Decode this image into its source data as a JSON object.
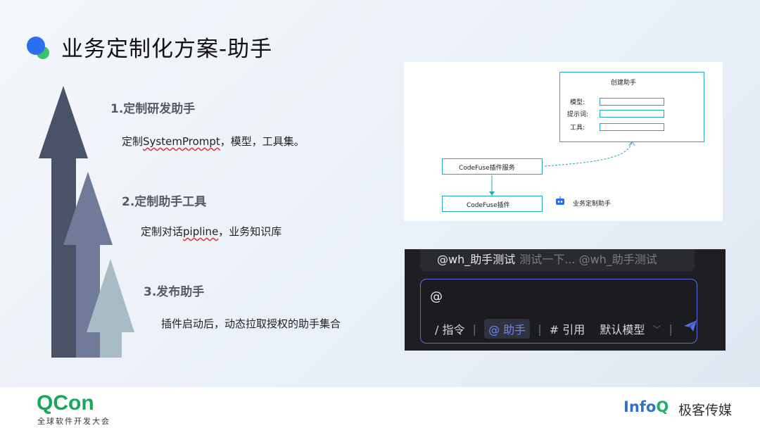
{
  "slide": {
    "title": "业务定制化方案-助手"
  },
  "steps": [
    {
      "title": "1.定制研发助手",
      "desc_prefix": "定制",
      "desc_mark": "SystemPrompt",
      "desc_suffix": "，模型，工具集。"
    },
    {
      "title": "2.定制助手工具",
      "desc_prefix": "定制对话",
      "desc_mark": "pipline",
      "desc_suffix": "，业务知识库"
    },
    {
      "title": "3.发布助手",
      "desc": "插件启动后，动态拉取授权的助手集合"
    }
  ],
  "diagram": {
    "create_title": "创建助手",
    "fields": [
      "模型:",
      "提示词:",
      "工具:"
    ],
    "service_box": "CodeFuse插件服务",
    "plugin_box": "CodeFuse插件",
    "assistant_label": "业务定制助手"
  },
  "chat": {
    "mention_name": "@wh_助手测试",
    "mention_preview": "测试一下... @wh_助手测试",
    "input_value": "@",
    "cmd_label": "/ 指令",
    "assist_label": "@ 助手",
    "ref_label": "# 引用",
    "model_label": "默认模型"
  },
  "footer": {
    "qcon_logo": "QCon",
    "qcon_sub": "全球软件开发大会",
    "infoq_a": "Info",
    "infoq_b": "Q",
    "infoq_media": "极客传媒"
  },
  "colors": {
    "accent_blue": "#2b6ff0",
    "accent_green": "#3cc36a",
    "arrow_dark": "#4a5268",
    "arrow_mid": "#707b99",
    "arrow_light": "#a8bcc6",
    "diagram_cyan": "#1fa8c4",
    "chat_accent": "#5b6ee0"
  }
}
